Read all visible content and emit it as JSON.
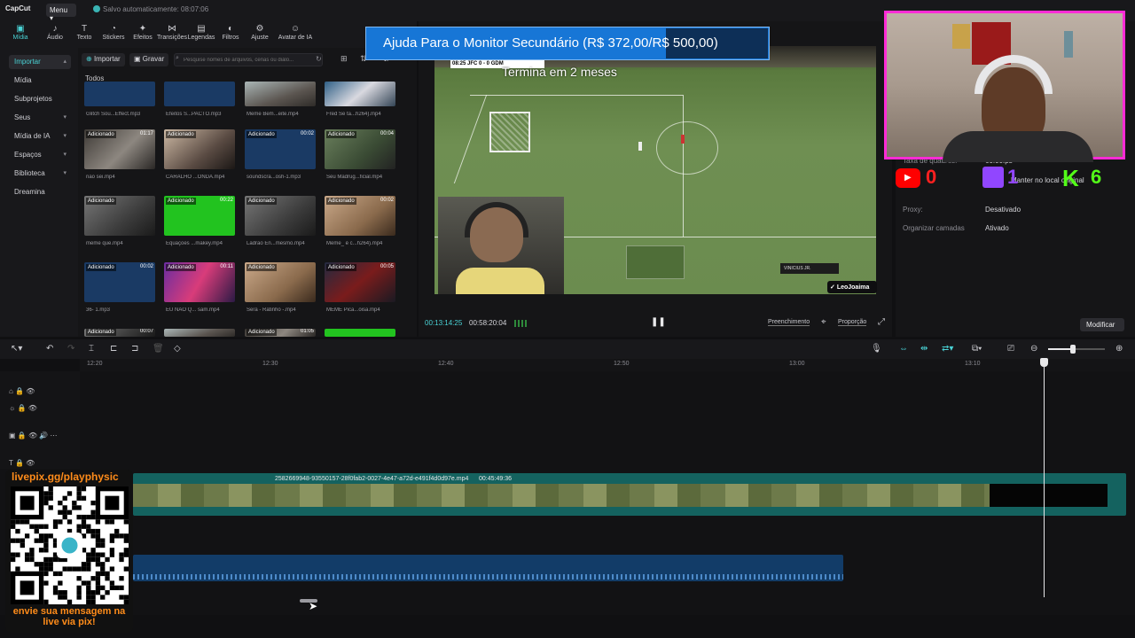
{
  "app": {
    "logo": "CapCut",
    "menu_label": "Menu",
    "autosave": "Salvo automaticamente: 08:07:06",
    "stream_url_top": "livepix.gg/playphysic"
  },
  "toolbar": [
    {
      "label": "Mídia",
      "icon": "media-icon",
      "active": true
    },
    {
      "label": "Áudio",
      "icon": "audio-icon"
    },
    {
      "label": "Texto",
      "icon": "text-icon"
    },
    {
      "label": "Stickers",
      "icon": "sticker-icon"
    },
    {
      "label": "Efeitos",
      "icon": "effects-icon"
    },
    {
      "label": "Transições",
      "icon": "transition-icon"
    },
    {
      "label": "Legendas",
      "icon": "captions-icon"
    },
    {
      "label": "Filtros",
      "icon": "filter-icon"
    },
    {
      "label": "Ajuste",
      "icon": "adjust-icon"
    },
    {
      "label": "Avatar de IA",
      "icon": "avatar-icon"
    }
  ],
  "left_nav": [
    {
      "label": "Importar",
      "selected": true,
      "chevron": true
    },
    {
      "label": "Mídia",
      "selected": false,
      "chevron": false
    },
    {
      "label": "Subprojetos",
      "selected": false,
      "chevron": false
    },
    {
      "label": "Seus",
      "selected": false,
      "chevron": true
    },
    {
      "label": "Mídia de IA",
      "selected": false,
      "chevron": true
    },
    {
      "label": "Espaços",
      "selected": false,
      "chevron": true
    },
    {
      "label": "Biblioteca",
      "selected": false,
      "chevron": true
    },
    {
      "label": "Dreamina",
      "selected": false,
      "chevron": false
    }
  ],
  "media": {
    "import_label": "Importar",
    "record_label": "Gravar",
    "search_placeholder": "Pesquise nomes de arquivos, cenas ou diálo...",
    "section_label": "Todos",
    "items": [
      {
        "name": "Glitch Sou...Effect.mp3",
        "badge": "",
        "dur": "",
        "style": "audio-bg"
      },
      {
        "name": "Efeitos S...PACTO.mp3",
        "badge": "",
        "dur": "",
        "style": "audio-bg"
      },
      {
        "name": "Meme Bem...eite.mp4",
        "badge": "",
        "dur": "",
        "style": "photo-b"
      },
      {
        "name": "Fred Se ta...h264).mp4",
        "badge": "",
        "dur": "",
        "style": "photo-i"
      },
      {
        "name": "nao sei.mp4",
        "badge": "Adicionado",
        "dur": "01:17",
        "style": "photo-a"
      },
      {
        "name": "CARALHO ...ONDA.mp4",
        "badge": "Adicionado",
        "dur": "",
        "style": "photo-h"
      },
      {
        "name": "soundscra...osh-1.mp3",
        "badge": "Adicionado",
        "dur": "00:02",
        "style": "audio-bg"
      },
      {
        "name": "Seu Madrug...ficial.mp4",
        "badge": "Adicionado",
        "dur": "00:04",
        "style": "photo-c"
      },
      {
        "name": "meme que.mp4",
        "badge": "Adicionado",
        "dur": "",
        "style": "photo-g"
      },
      {
        "name": "Equações ...makey.mp4",
        "badge": "Adicionado",
        "dur": "00:22",
        "style": "green-bg"
      },
      {
        "name": "Ladrão En...mesmo.mp4",
        "badge": "Adicionado",
        "dur": "",
        "style": "photo-g"
      },
      {
        "name": "Meme_ é c...h264).mp4",
        "badge": "Adicionado",
        "dur": "00:02",
        "style": "photo-e"
      },
      {
        "name": "36- 1.mp3",
        "badge": "Adicionado",
        "dur": "00:02",
        "style": "audio-bg"
      },
      {
        "name": "EU NÃO Q... sam.mp4",
        "badge": "Adicionado",
        "dur": "00:11",
        "style": "photo-d"
      },
      {
        "name": "Será - Ratinho -.mp4",
        "badge": "Adicionado",
        "dur": "",
        "style": "photo-e"
      },
      {
        "name": "MEME Pica...oisa.mp4",
        "badge": "Adicionado",
        "dur": "00:05",
        "style": "photo-f"
      }
    ],
    "partial_badges": [
      "Adicionado",
      "",
      "Adicionado",
      ""
    ],
    "partial_durs": [
      "00:07",
      "",
      "01:05",
      ""
    ]
  },
  "preview": {
    "donation_text": "Ajuda Para o Monitor Secundário (R$ 372,00/R$ 500,00)",
    "donation_progress": 0.744,
    "score_bug": "08:25  JFC  0 - 0  GDM",
    "ends_text": "Termina em 2 meses",
    "player_name": "VINICIUS JR.",
    "channel_tag": "LeoJoaima",
    "timecode": "00:13:14:25",
    "duration": "00:58:20:04",
    "btn_fill": "Preenchimento",
    "btn_ratio": "Proporção"
  },
  "properties": {
    "frame_rate_label": "Taxa de quadros:",
    "frame_rate_value": "60.00fps",
    "original_label": "Manter no local original",
    "proxy_label": "Proxy:",
    "proxy_value": "Desativado",
    "organize_label": "Organizar camadas",
    "organize_value": "Ativado",
    "modify_label": "Modificar"
  },
  "social": {
    "youtube_count": "0",
    "twitch_count": "1",
    "kick_count": "6"
  },
  "timeline": {
    "ticks": [
      "12:20",
      "12:30",
      "12:40",
      "12:50",
      "13:00",
      "13:10"
    ],
    "clip_label": "2582669948-93550157-28f0fab2-0027-4e47-a72d-e491f4d0d97e.mp4",
    "clip_duration": "00:45:49:36"
  },
  "overlay": {
    "qr_url": "livepix.gg/playphysic",
    "qr_msg": "envie sua mensagem na live via pix!"
  },
  "colors": {
    "accent": "#4ad3d6",
    "webcam_border": "#ff2bd6",
    "donation": "#1776d6",
    "overlay_text": "#ff8c1a"
  }
}
